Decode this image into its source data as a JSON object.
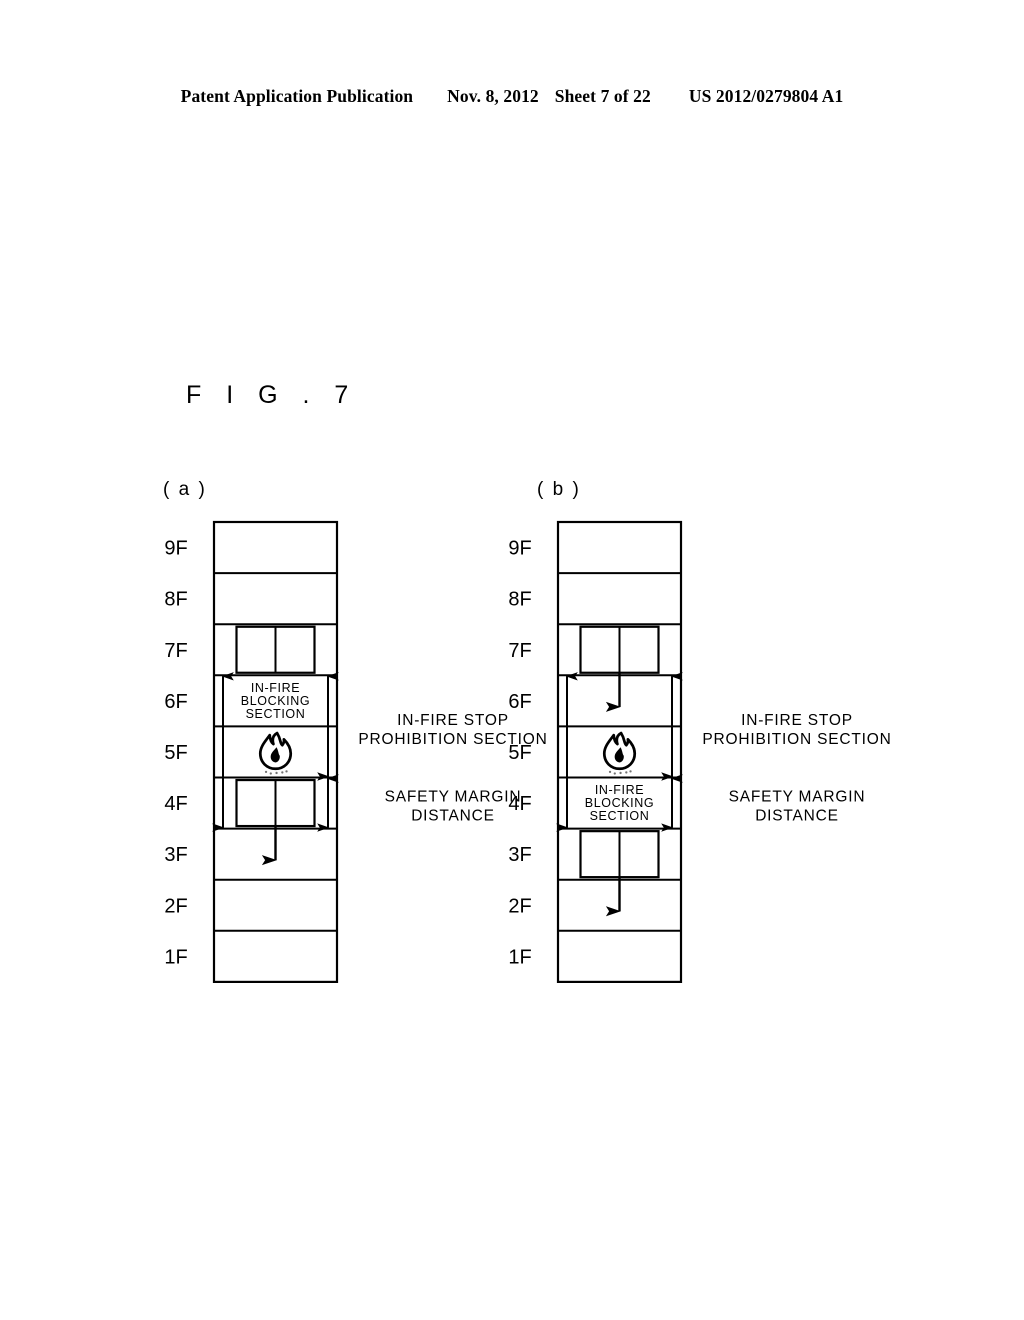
{
  "header": {
    "publication": "Patent Application Publication",
    "date": "Nov. 8, 2012",
    "sheet": "Sheet 7 of 22",
    "patent_number": "US 2012/0279804 A1"
  },
  "figure": {
    "title": "F I G .  7"
  },
  "colors": {
    "ink": "#000000",
    "paper": "#ffffff"
  },
  "panels": [
    {
      "id": "a",
      "label": "( a )",
      "floors": [
        "9F",
        "8F",
        "7F",
        "6F",
        "5F",
        "4F",
        "3F",
        "2F",
        "1F"
      ],
      "fire_floor": "5F",
      "blocking_section_floor": "6F",
      "blocking_section_label": "IN-FIRE\nBLOCKING\nSECTION",
      "blocking_section_lines": [
        "IN-FIRE",
        "BLOCKING",
        "SECTION"
      ],
      "cars": [
        {
          "floor": "7F",
          "has_arrow": false
        },
        {
          "floor": "4F",
          "has_arrow": true,
          "arrow_to": "3F",
          "arrow_direction": "down"
        }
      ],
      "annotations": [
        {
          "name": "in-fire-stop-prohibition-section",
          "lines": [
            "IN-FIRE STOP",
            "PROHIBITION SECTION"
          ],
          "span_from": "6F",
          "span_to": "4F"
        },
        {
          "name": "safety-margin-distance",
          "lines": [
            "SAFETY MARGIN",
            "DISTANCE"
          ],
          "span_from": "4F",
          "span_to": "4F"
        }
      ]
    },
    {
      "id": "b",
      "label": "( b )",
      "floors": [
        "9F",
        "8F",
        "7F",
        "6F",
        "5F",
        "4F",
        "3F",
        "2F",
        "1F"
      ],
      "fire_floor": "5F",
      "blocking_section_floor": "4F",
      "blocking_section_label": "IN-FIRE\nBLOCKING\nSECTION",
      "blocking_section_lines": [
        "IN-FIRE",
        "BLOCKING",
        "SECTION"
      ],
      "cars": [
        {
          "floor": "7F",
          "has_arrow": true,
          "arrow_to": "6F",
          "arrow_direction": "down"
        },
        {
          "floor": "3F",
          "has_arrow": true,
          "arrow_to": "2F",
          "arrow_direction": "down"
        }
      ],
      "annotations": [
        {
          "name": "in-fire-stop-prohibition-section",
          "lines": [
            "IN-FIRE STOP",
            "PROHIBITION SECTION"
          ],
          "span_from": "6F",
          "span_to": "4F"
        },
        {
          "name": "safety-margin-distance",
          "lines": [
            "SAFETY MARGIN",
            "DISTANCE"
          ],
          "span_from": "4F",
          "span_to": "4F"
        }
      ]
    }
  ],
  "icons": {
    "flame": "flame-icon",
    "elevator_car": "elevator-car-icon"
  }
}
